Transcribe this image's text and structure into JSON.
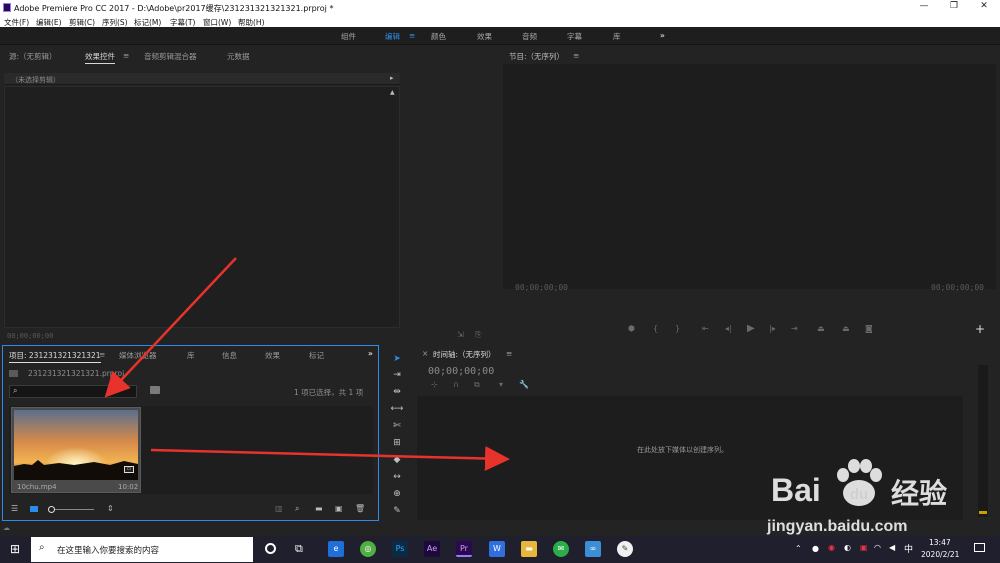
{
  "window": {
    "title": "Adobe Premiere Pro CC 2017 - D:\\Adobe\\pr2017缓存\\231231321321321.prproj *",
    "minimize": "—",
    "restore": "❐",
    "close": "✕"
  },
  "menu": [
    "文件(F)",
    "编辑(E)",
    "剪辑(C)",
    "序列(S)",
    "标记(M)",
    "字幕(T)",
    "窗口(W)",
    "帮助(H)"
  ],
  "workspaces": [
    "组件",
    "编辑",
    "颜色",
    "效果",
    "音频",
    "字幕",
    "库"
  ],
  "workspace_more": "»",
  "source_panel": {
    "tabs": [
      "源:（无剪辑）",
      "效果控件",
      "音频剪辑混合器",
      "元数据"
    ],
    "menu_icon": "≡",
    "no_clip": "（未选择剪辑）",
    "timecode": "00;00;00;00"
  },
  "program_panel": {
    "title": "节目:（无序列）",
    "menu_icon": "≡",
    "timecode_left": "00;00;00;00",
    "timecode_right": "00;00;00;00",
    "add": "+"
  },
  "project_panel": {
    "tabs": [
      "项目: 231231321321321",
      "媒体浏览器",
      "库",
      "信息",
      "效果",
      "标记"
    ],
    "more": "»",
    "file": "231231321321321.prproj",
    "selection": "1 项已选择，共 1 项",
    "clip_name": "10chu.mp4",
    "clip_duration": "10:02"
  },
  "timeline_panel": {
    "title": "时间轴:（无序列）",
    "close": "×",
    "menu_icon": "≡",
    "timecode": "00;00;00;00",
    "drop_hint": "在此处放下媒体以创建序列。"
  },
  "watermark": {
    "logo": "Bai",
    "logo_cn": "经验",
    "url": "jingyan.baidu.com"
  },
  "taskbar": {
    "search_placeholder": "在这里输入你要搜索的内容",
    "time": "13:47",
    "date": "2020/2/21",
    "ime": "中"
  },
  "colors": {
    "accent_blue": "#2d8ceb",
    "arrow_red": "#e8322c",
    "taskbar": "#1f1f2e"
  }
}
